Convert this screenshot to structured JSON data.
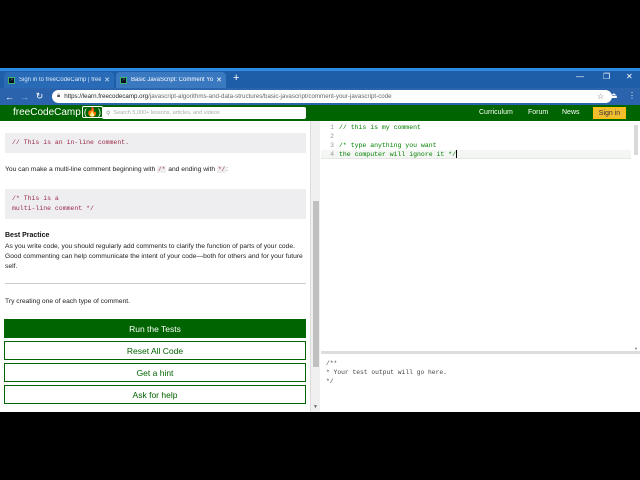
{
  "browser": {
    "tabs": [
      {
        "title": "Sign in to freeCodeCamp | freeC",
        "active": false
      },
      {
        "title": "Basic JavaScript: Comment Your",
        "active": true
      }
    ],
    "new_tab": "+",
    "url_host": "https://learn.freecodecamp.org",
    "url_path": "/javascript-algorithms-and-data-structures/basic-javascript/comment-your-javascript-code"
  },
  "fcc_nav": {
    "logo": "freeCodeCamp",
    "logo_flame": "(🔥)",
    "search_placeholder": "Search 5,000+ lessons, articles, and videos",
    "links": [
      "Curriculum",
      "Forum",
      "News"
    ],
    "signin": "Sign in"
  },
  "lesson": {
    "inline_example": "// This is an in-line comment.",
    "multiline_intro_before": "You can make a multi-line comment beginning with ",
    "multiline_start_token": "/*",
    "multiline_intro_middle": " and ending with ",
    "multiline_end_token": "*/",
    "multiline_intro_after": ":",
    "multiline_example": "/* This is a\nmulti-line comment */",
    "best_practice_heading": "Best Practice",
    "best_practice_text": "As you write code, you should regularly add comments to clarify the function of parts of your code. Good commenting can help communicate the intent of your code—both for others and for your future self.",
    "instruction": "Try creating one of each type of comment.",
    "buttons": {
      "run": "Run the Tests",
      "reset": "Reset All Code",
      "hint": "Get a hint",
      "help": "Ask for help"
    }
  },
  "editor": {
    "lines": [
      {
        "num": "1",
        "text": "// this is my comment"
      },
      {
        "num": "2",
        "text": ""
      },
      {
        "num": "3",
        "text": "/* type anything you want"
      },
      {
        "num": "4",
        "text": "the computer will ignore it */"
      }
    ]
  },
  "output": {
    "text": "/**\n* Your test output will go here.\n*/"
  }
}
